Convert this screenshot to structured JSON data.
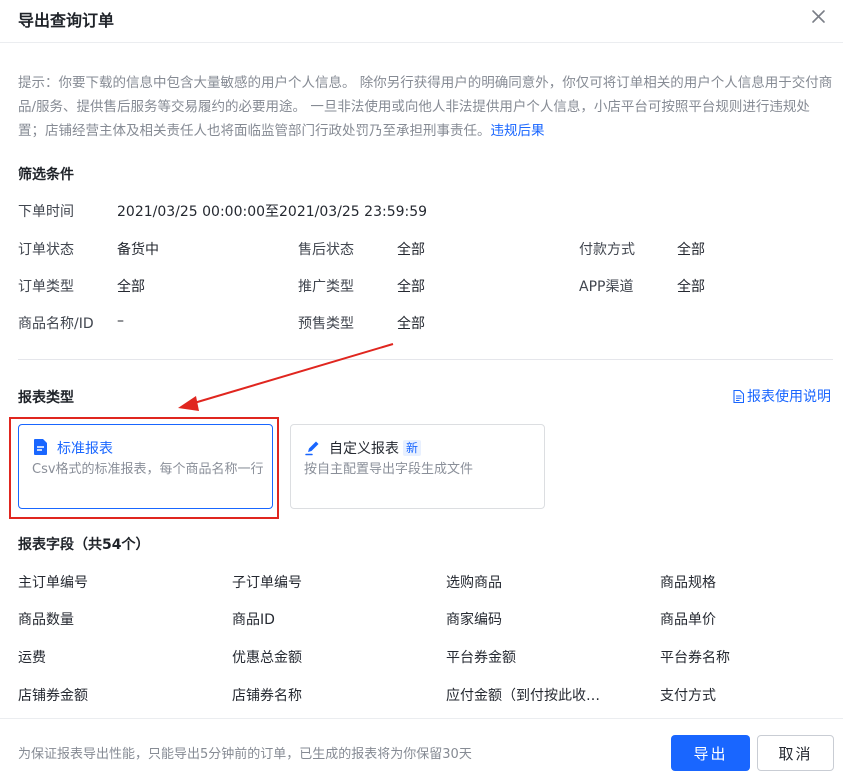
{
  "dialog": {
    "title": "导出查询订单",
    "close_icon": "close-icon"
  },
  "notice": {
    "text": "提示：你要下载的信息中包含大量敏感的用户个人信息。 除你另行获得用户的明确同意外，你仅可将订单相关的用户个人信息用于交付商品/服务、提供售后服务等交易履约的必要用途。 一旦非法使用或向他人非法提供用户个人信息，小店平台可按照平台规则进行违规处置；店铺经营主体及相关责任人也将面临监管部门行政处罚乃至承担刑事责任。",
    "link": "违规后果"
  },
  "filters": {
    "title": "筛选条件",
    "order_time": {
      "label": "下单时间",
      "value": "2021/03/25 00:00:00至2021/03/25 23:59:59"
    },
    "order_status": {
      "label": "订单状态",
      "value": "备货中"
    },
    "after_sale_status": {
      "label": "售后状态",
      "value": "全部"
    },
    "payment_method": {
      "label": "付款方式",
      "value": "全部"
    },
    "order_type": {
      "label": "订单类型",
      "value": "全部"
    },
    "promo_type": {
      "label": "推广类型",
      "value": "全部"
    },
    "app_channel": {
      "label": "APP渠道",
      "value": "全部"
    },
    "product_name_id": {
      "label": "商品名称/ID",
      "value": "–"
    },
    "presale_type": {
      "label": "预售类型",
      "value": "全部"
    }
  },
  "report_type": {
    "title": "报表类型",
    "guide_link": "报表使用说明",
    "standard": {
      "title": "标准报表",
      "desc": "Csv格式的标准报表，每个商品名称一行",
      "selected": true
    },
    "custom": {
      "title": "自定义报表",
      "badge": "新",
      "desc": "按自主配置导出字段生成文件"
    }
  },
  "report_fields": {
    "title": "报表字段（共54个）",
    "items": [
      "主订单编号",
      "子订单编号",
      "选购商品",
      "商品规格",
      "商品数量",
      "商品ID",
      "商家编码",
      "商品单价",
      "运费",
      "优惠总金额",
      "平台券金额",
      "平台券名称",
      "店铺券金额",
      "店铺券名称",
      "应付金额（到付按此收…",
      "支付方式"
    ]
  },
  "footer": {
    "note": "为保证报表导出性能，只能导出5分钟前的订单，已生成的报表将为你保留30天",
    "export_label": "导出",
    "cancel_label": "取消"
  },
  "colors": {
    "accent": "#1966ff",
    "annotation": "#e0261f"
  }
}
